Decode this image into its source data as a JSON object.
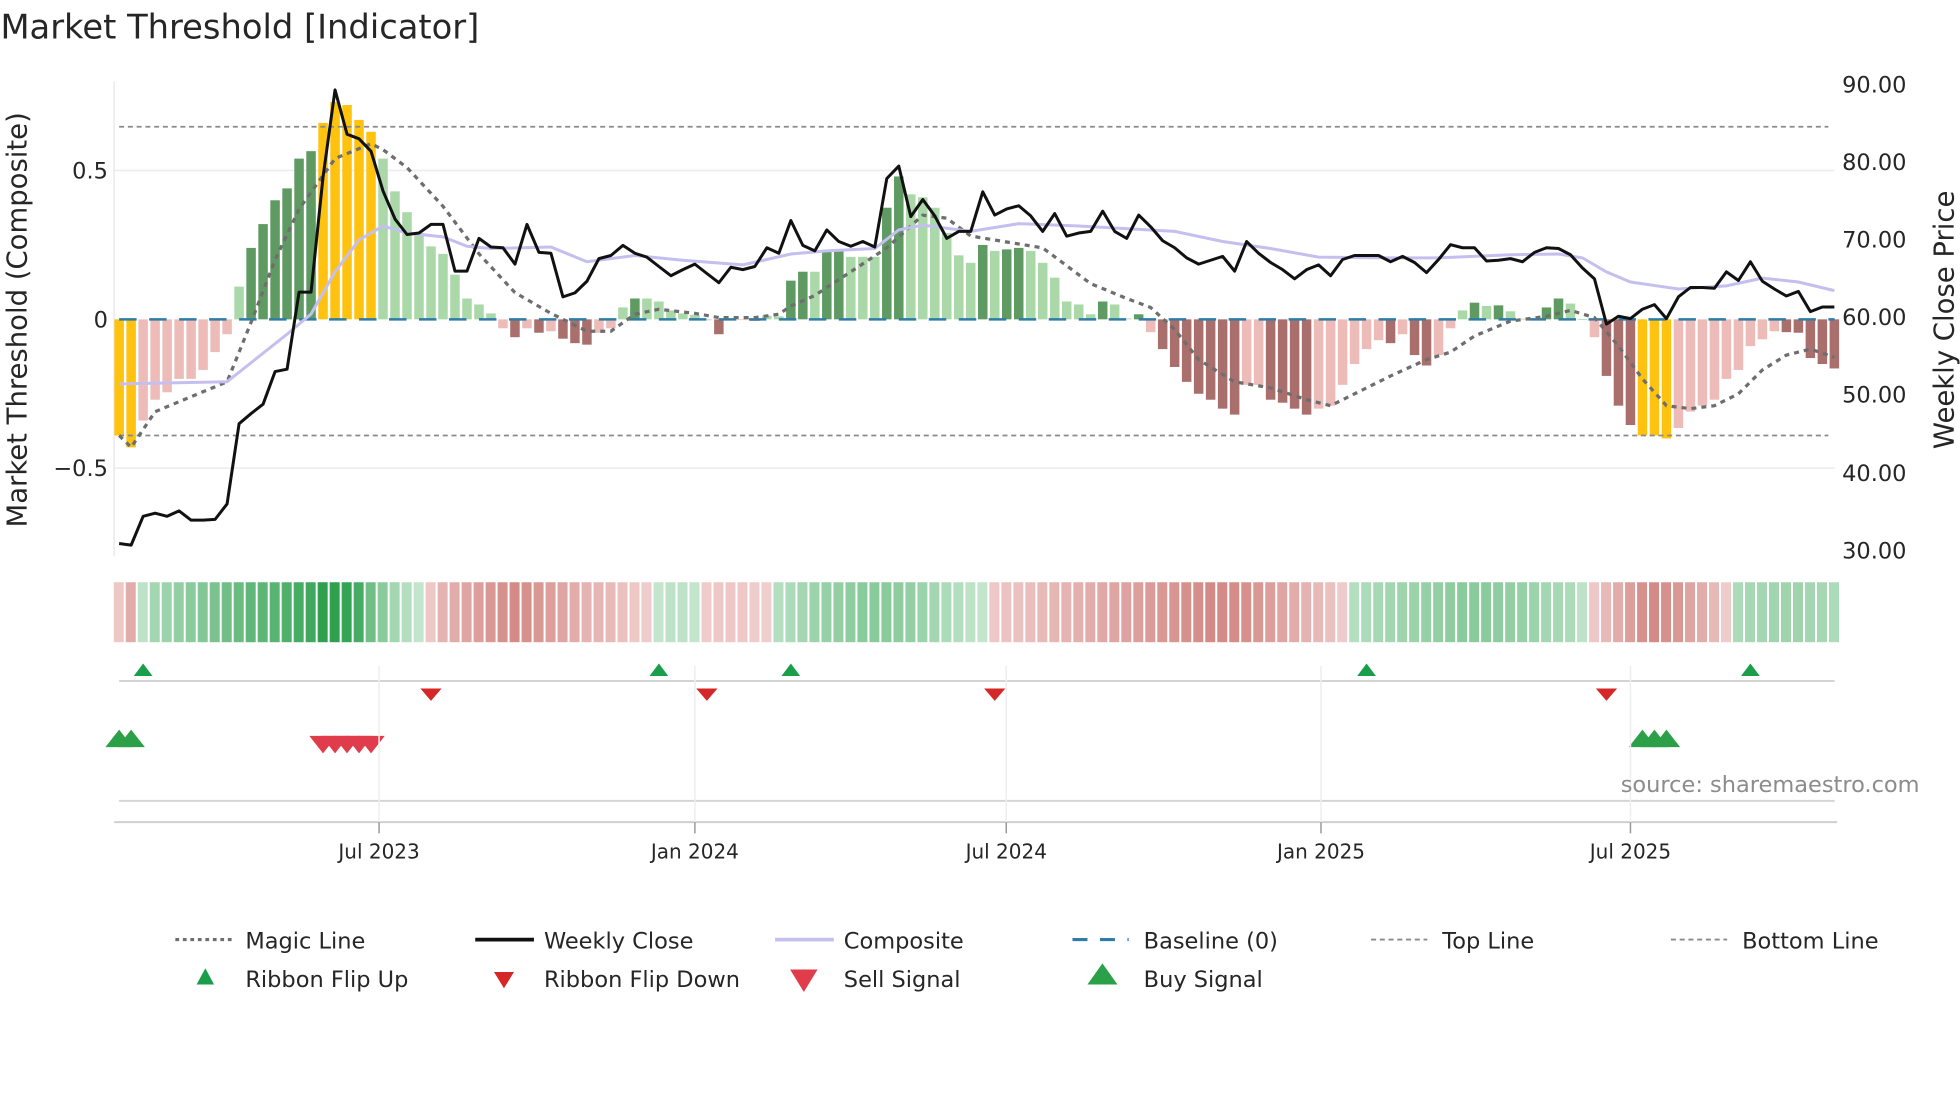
{
  "title": "Market Threshold [Indicator]",
  "source": "source: sharemaestro.com",
  "colors": {
    "extreme": "#FFC20E",
    "pos_strong": "#5E9A62",
    "pos_weak": "#AAD8A8",
    "neg_strong": "#A86F6D",
    "neg_weak": "#EDBCB9",
    "weekly_close": "#111111",
    "composite": "#C5BFEF",
    "magic": "#6E6E6E",
    "baseline": "#2E7DA8",
    "threshold": "#8A8A8A",
    "flip_up": "#1A9E4A",
    "flip_down": "#D62728",
    "buy": "#2CA048",
    "sell": "#E03C4B"
  },
  "chart_data": {
    "type": "bar",
    "title": "Market Threshold [Indicator]",
    "left_axis": {
      "label": "Market Threshold (Composite)",
      "range": [
        -0.795,
        0.8
      ],
      "ticks": [
        {
          "value": 0.5,
          "label": "0.5"
        },
        {
          "value": 0,
          "label": "0"
        },
        {
          "value": -0.5,
          "label": "−0.5"
        }
      ]
    },
    "right_axis": {
      "label": "Weekly Close Price",
      "range": [
        29.3,
        90.3
      ],
      "ticks": [
        {
          "value": 90,
          "label": "90.00"
        },
        {
          "value": 80,
          "label": "80.00"
        },
        {
          "value": 70,
          "label": "70.00"
        },
        {
          "value": 60,
          "label": "60.00"
        },
        {
          "value": 50,
          "label": "50.00"
        },
        {
          "value": 40,
          "label": "40.00"
        },
        {
          "value": 30,
          "label": "30.00"
        }
      ]
    },
    "x_ticks": [
      {
        "week": 21.67,
        "label": "Jul 2023"
      },
      {
        "week": 48.0,
        "label": "Jan 2024"
      },
      {
        "week": 73.96,
        "label": "Jul 2024"
      },
      {
        "week": 100.2,
        "label": "Jan 2025"
      },
      {
        "week": 126.0,
        "label": "Jul 2025"
      }
    ],
    "grid": true,
    "top_line": 0.647,
    "bottom_line": -0.39,
    "baseline": 0,
    "extreme_upper": 0.6,
    "extreme_lower": -0.38,
    "composite_bars": [
      -0.39,
      -0.43,
      -0.34,
      -0.27,
      -0.245,
      -0.2,
      -0.2,
      -0.17,
      -0.11,
      -0.05,
      0.11,
      0.24,
      0.32,
      0.4,
      0.44,
      0.54,
      0.565,
      0.66,
      0.73,
      0.72,
      0.67,
      0.63,
      0.54,
      0.43,
      0.36,
      0.29,
      0.245,
      0.22,
      0.15,
      0.07,
      0.05,
      0.02,
      -0.03,
      -0.06,
      -0.03,
      -0.045,
      -0.04,
      -0.065,
      -0.08,
      -0.085,
      -0.045,
      -0.03,
      0.04,
      0.07,
      0.07,
      0.06,
      0.03,
      0.02,
      0.015,
      -0.003,
      -0.05,
      -0.002,
      -0.001,
      -0.005,
      0.012,
      0.01,
      0.13,
      0.16,
      0.16,
      0.23,
      0.235,
      0.21,
      0.21,
      0.21,
      0.375,
      0.48,
      0.42,
      0.41,
      0.375,
      0.29,
      0.215,
      0.19,
      0.25,
      0.23,
      0.235,
      0.24,
      0.23,
      0.19,
      0.14,
      0.06,
      0.05,
      0.017,
      0.06,
      0.05,
      0.003,
      0.017,
      -0.043,
      -0.1,
      -0.16,
      -0.21,
      -0.25,
      -0.27,
      -0.3,
      -0.32,
      -0.22,
      -0.22,
      -0.27,
      -0.28,
      -0.3,
      -0.32,
      -0.3,
      -0.29,
      -0.22,
      -0.15,
      -0.1,
      -0.07,
      -0.08,
      -0.05,
      -0.12,
      -0.155,
      -0.12,
      -0.03,
      0.03,
      0.056,
      0.045,
      0.047,
      0.027,
      0.002,
      0.003,
      0.04,
      0.07,
      0.053,
      0.001,
      -0.06,
      -0.19,
      -0.29,
      -0.355,
      -0.39,
      -0.39,
      -0.4,
      -0.365,
      -0.31,
      -0.29,
      -0.27,
      -0.2,
      -0.17,
      -0.09,
      -0.067,
      -0.04,
      -0.043,
      -0.045,
      -0.13,
      -0.15,
      -0.165
    ],
    "weekly_close": [
      30.9,
      30.7,
      34.4,
      34.8,
      34.4,
      35.1,
      33.9,
      33.9,
      34.0,
      36.0,
      46.3,
      47.6,
      48.8,
      53.0,
      53.3,
      63.2,
      63.2,
      78.0,
      89.2,
      83.5,
      82.9,
      81.3,
      76.2,
      72.6,
      70.6,
      70.8,
      71.9,
      71.9,
      65.9,
      65.9,
      70.1,
      69.0,
      68.9,
      66.8,
      71.9,
      68.3,
      68.2,
      62.6,
      63.1,
      64.6,
      67.5,
      67.9,
      69.2,
      68.2,
      67.7,
      66.5,
      65.3,
      66.1,
      66.8,
      65.6,
      64.4,
      66.4,
      66.1,
      66.5,
      68.9,
      68.2,
      72.4,
      69.2,
      68.5,
      71.2,
      69.7,
      69.1,
      69.7,
      69.0,
      77.8,
      79.4,
      72.9,
      75.1,
      73.0,
      70.1,
      71.0,
      71.0,
      76.1,
      73.1,
      73.9,
      74.3,
      73.0,
      71.0,
      73.3,
      70.4,
      70.8,
      71.0,
      73.6,
      71.0,
      70.1,
      73.1,
      71.6,
      69.8,
      68.9,
      67.6,
      66.8,
      67.3,
      67.8,
      65.9,
      69.7,
      68.2,
      67.0,
      66.1,
      64.9,
      66.1,
      66.7,
      65.3,
      67.4,
      67.9,
      67.9,
      67.9,
      67.1,
      67.8,
      67.0,
      65.7,
      67.4,
      69.3,
      68.9,
      68.9,
      67.2,
      67.3,
      67.5,
      67.1,
      68.3,
      68.9,
      68.8,
      68.0,
      66.3,
      64.9,
      59.1,
      60.1,
      59.8,
      61.0,
      61.6,
      59.8,
      62.6,
      63.8,
      63.8,
      63.7,
      65.8,
      64.7,
      67.1,
      64.6,
      63.6,
      62.7,
      63.3,
      60.7,
      61.3,
      61.3
    ],
    "composite_line": [
      [
        0,
        51.4
      ],
      [
        9,
        51.7
      ],
      [
        14,
        57.8
      ],
      [
        16,
        60.4
      ],
      [
        18,
        65.8
      ],
      [
        20,
        69.9
      ],
      [
        22,
        71.7
      ],
      [
        24,
        70.8
      ],
      [
        27,
        70.3
      ],
      [
        29,
        69.1
      ],
      [
        31,
        68.8
      ],
      [
        36,
        69.0
      ],
      [
        39,
        67.1
      ],
      [
        43,
        67.9
      ],
      [
        47,
        67.3
      ],
      [
        52,
        66.7
      ],
      [
        56,
        68.1
      ],
      [
        59,
        68.5
      ],
      [
        63,
        68.8
      ],
      [
        65,
        71.2
      ],
      [
        67,
        71.8
      ],
      [
        71,
        71.0
      ],
      [
        75,
        72.0
      ],
      [
        80,
        71.7
      ],
      [
        88,
        71.0
      ],
      [
        92,
        69.7
      ],
      [
        96,
        68.8
      ],
      [
        100,
        67.7
      ],
      [
        106,
        67.6
      ],
      [
        110,
        67.6
      ],
      [
        116,
        68.0
      ],
      [
        120,
        68.1
      ],
      [
        122,
        67.6
      ],
      [
        124,
        65.8
      ],
      [
        126,
        64.5
      ],
      [
        130,
        63.6
      ],
      [
        134,
        64.0
      ],
      [
        137,
        65.0
      ],
      [
        140,
        64.5
      ],
      [
        143,
        63.4
      ]
    ],
    "magic_line": [
      [
        0,
        -0.39
      ],
      [
        1,
        -0.43
      ],
      [
        3,
        -0.31
      ],
      [
        6,
        -0.26
      ],
      [
        9,
        -0.21
      ],
      [
        11,
        -0.01
      ],
      [
        13,
        0.2
      ],
      [
        15,
        0.37
      ],
      [
        18,
        0.54
      ],
      [
        21,
        0.59
      ],
      [
        22,
        0.57
      ],
      [
        24,
        0.51
      ],
      [
        27,
        0.38
      ],
      [
        30,
        0.22
      ],
      [
        33,
        0.09
      ],
      [
        36,
        0.02
      ],
      [
        39,
        -0.04
      ],
      [
        41,
        -0.04
      ],
      [
        43,
        0.017
      ],
      [
        45,
        0.034
      ],
      [
        48,
        0.02
      ],
      [
        50,
        0.006
      ],
      [
        53,
        0.006
      ],
      [
        55,
        0.017
      ],
      [
        56,
        0.045
      ],
      [
        58,
        0.08
      ],
      [
        61,
        0.16
      ],
      [
        64,
        0.24
      ],
      [
        67,
        0.35
      ],
      [
        69,
        0.34
      ],
      [
        71,
        0.28
      ],
      [
        74,
        0.26
      ],
      [
        77,
        0.24
      ],
      [
        79,
        0.18
      ],
      [
        81,
        0.12
      ],
      [
        84,
        0.07
      ],
      [
        86,
        0.04
      ],
      [
        88,
        -0.034
      ],
      [
        90,
        -0.135
      ],
      [
        93,
        -0.21
      ],
      [
        96,
        -0.23
      ],
      [
        99,
        -0.27
      ],
      [
        101,
        -0.29
      ],
      [
        103,
        -0.25
      ],
      [
        106,
        -0.19
      ],
      [
        109,
        -0.135
      ],
      [
        111,
        -0.11
      ],
      [
        113,
        -0.056
      ],
      [
        116,
        -0.006
      ],
      [
        119,
        0.01
      ],
      [
        121,
        0.03
      ],
      [
        123,
        0.006
      ],
      [
        125,
        -0.09
      ],
      [
        127,
        -0.2
      ],
      [
        129,
        -0.29
      ],
      [
        131,
        -0.3
      ],
      [
        133,
        -0.29
      ],
      [
        135,
        -0.25
      ],
      [
        137,
        -0.17
      ],
      [
        139,
        -0.12
      ],
      [
        141,
        -0.1
      ],
      [
        143,
        -0.127
      ]
    ],
    "ribbon": [
      -0.15,
      -0.35,
      0.15,
      0.3,
      0.35,
      0.4,
      0.45,
      0.5,
      0.55,
      0.6,
      0.65,
      0.7,
      0.72,
      0.75,
      0.8,
      0.85,
      0.9,
      1.0,
      1.0,
      0.95,
      0.85,
      0.6,
      0.45,
      0.3,
      0.2,
      0.12,
      -0.15,
      -0.3,
      -0.35,
      -0.4,
      -0.45,
      -0.5,
      -0.55,
      -0.6,
      -0.55,
      -0.5,
      -0.45,
      -0.4,
      -0.35,
      -0.3,
      -0.28,
      -0.25,
      -0.2,
      -0.15,
      -0.12,
      0.12,
      0.15,
      0.15,
      0.12,
      -0.12,
      -0.15,
      -0.15,
      -0.15,
      -0.12,
      -0.1,
      0.2,
      0.25,
      0.3,
      0.35,
      0.38,
      0.4,
      0.42,
      0.45,
      0.45,
      0.45,
      0.42,
      0.4,
      0.35,
      0.3,
      0.25,
      0.2,
      0.15,
      0.12,
      -0.15,
      -0.18,
      -0.2,
      -0.22,
      -0.25,
      -0.28,
      -0.3,
      -0.32,
      -0.35,
      -0.38,
      -0.4,
      -0.42,
      -0.45,
      -0.47,
      -0.5,
      -0.52,
      -0.55,
      -0.57,
      -0.6,
      -0.6,
      -0.58,
      -0.55,
      -0.5,
      -0.45,
      -0.4,
      -0.35,
      -0.3,
      -0.25,
      -0.2,
      -0.12,
      0.2,
      0.25,
      0.28,
      0.3,
      0.33,
      0.35,
      0.38,
      0.4,
      0.42,
      0.45,
      0.45,
      0.45,
      0.42,
      0.4,
      0.38,
      0.35,
      0.3,
      0.28,
      0.25,
      0.15,
      -0.15,
      -0.25,
      -0.35,
      -0.45,
      -0.55,
      -0.6,
      -0.55,
      -0.5,
      -0.4,
      -0.35,
      -0.25,
      -0.12,
      0.25,
      0.28,
      0.3,
      0.32,
      0.33,
      0.33,
      0.3,
      0.28,
      0.25
    ],
    "ribbon_flip_up": [
      2,
      45,
      56,
      104,
      136
    ],
    "ribbon_flip_down": [
      26,
      49,
      73,
      124
    ],
    "buy_signal": [
      0,
      1,
      127,
      128,
      129
    ],
    "sell_signal": [
      17,
      18,
      19,
      20,
      21
    ],
    "legend": {
      "magic": "Magic Line",
      "close": "Weekly Close",
      "composite": "Composite",
      "baseline": "Baseline (0)",
      "top": "Top Line",
      "bottom": "Bottom Line",
      "flip_up": "Ribbon Flip Up",
      "flip_down": "Ribbon Flip Down",
      "sell": "Sell Signal",
      "buy": "Buy Signal"
    },
    "legend_placement": "bottom"
  }
}
